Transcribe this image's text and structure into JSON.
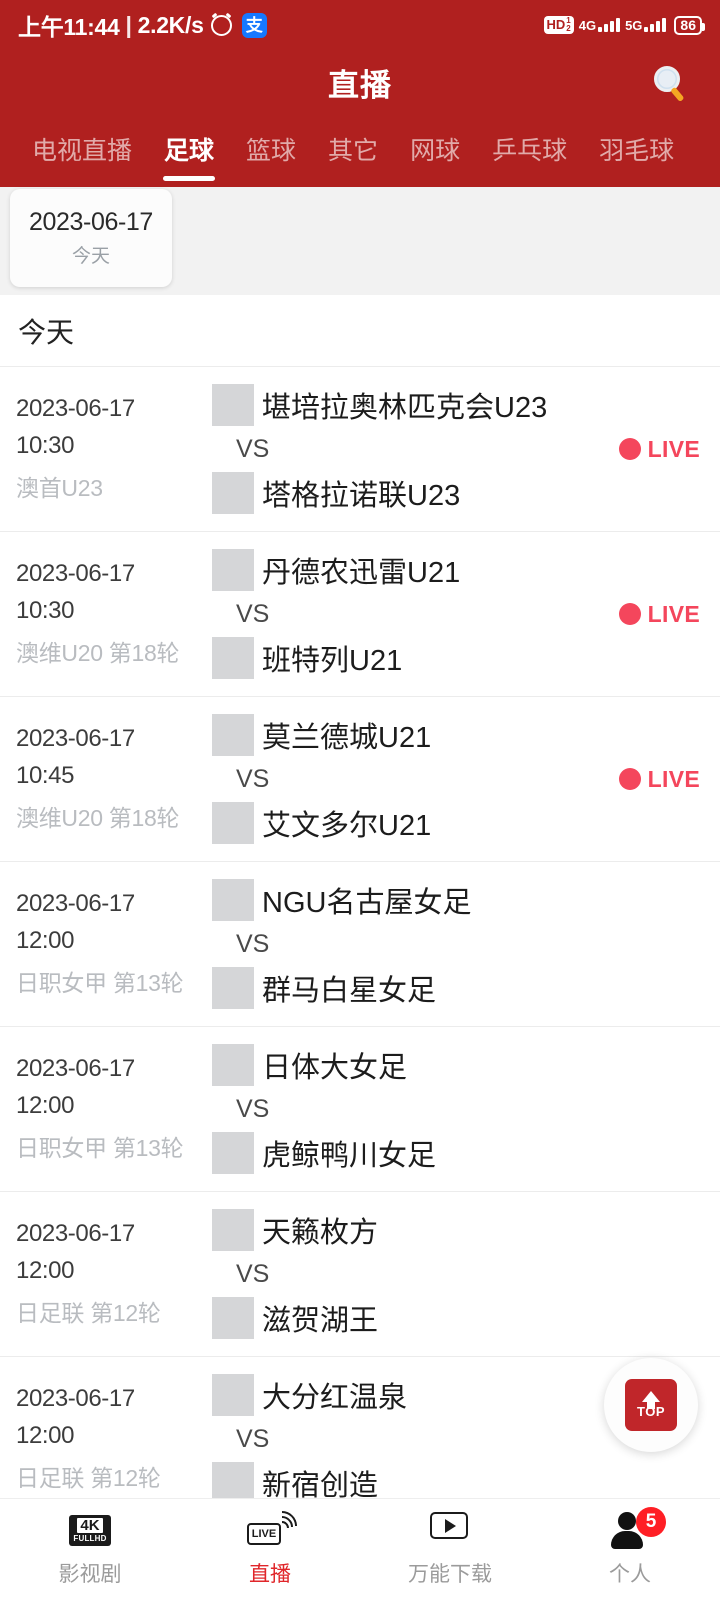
{
  "status_bar": {
    "time": "上午11:44",
    "separator": "|",
    "network_speed": "2.2K/s",
    "alarm_icon": "alarm-clock-icon",
    "alipay_icon": "支",
    "hd_label": "HD",
    "hd_num_top": "1",
    "hd_num_bottom": "2",
    "network_4g": "4G",
    "network_5g": "5G",
    "battery": "86"
  },
  "header": {
    "title": "直播",
    "search_icon": "search-icon"
  },
  "tabs": [
    {
      "label": "电视直播",
      "active": false
    },
    {
      "label": "足球",
      "active": true
    },
    {
      "label": "篮球",
      "active": false
    },
    {
      "label": "其它",
      "active": false
    },
    {
      "label": "网球",
      "active": false
    },
    {
      "label": "乒乓球",
      "active": false
    },
    {
      "label": "羽毛球",
      "active": false
    }
  ],
  "date_chips": [
    {
      "date": "2023-06-17",
      "label": "今天",
      "selected": true
    }
  ],
  "section": {
    "title": "今天"
  },
  "matches": [
    {
      "date": "2023-06-17",
      "time": "10:30",
      "league": "澳首U23",
      "home": "堪培拉奥林匹克会U23",
      "away": "塔格拉诺联U23",
      "vs": "VS",
      "status": "LIVE",
      "live": true
    },
    {
      "date": "2023-06-17",
      "time": "10:30",
      "league": "澳维U20 第18轮",
      "home": "丹德农迅雷U21",
      "away": "班特列U21",
      "vs": "VS",
      "status": "LIVE",
      "live": true
    },
    {
      "date": "2023-06-17",
      "time": "10:45",
      "league": "澳维U20 第18轮",
      "home": "莫兰德城U21",
      "away": "艾文多尔U21",
      "vs": "VS",
      "status": "LIVE",
      "live": true
    },
    {
      "date": "2023-06-17",
      "time": "12:00",
      "league": "日职女甲 第13轮",
      "home": "NGU名古屋女足",
      "away": "群马白星女足",
      "vs": "VS",
      "status": "",
      "live": false
    },
    {
      "date": "2023-06-17",
      "time": "12:00",
      "league": "日职女甲 第13轮",
      "home": "日体大女足",
      "away": "虎鲸鸭川女足",
      "vs": "VS",
      "status": "",
      "live": false
    },
    {
      "date": "2023-06-17",
      "time": "12:00",
      "league": "日足联 第12轮",
      "home": "天籁枚方",
      "away": "滋贺湖王",
      "vs": "VS",
      "status": "",
      "live": false
    },
    {
      "date": "2023-06-17",
      "time": "12:00",
      "league": "日足联 第12轮",
      "home": "大分红温泉",
      "away": "新宿创造",
      "vs": "VS",
      "status": "",
      "live": false
    }
  ],
  "scroll_top_button": {
    "label": "TOP",
    "icon": "arrow-up-icon"
  },
  "bottom_nav": [
    {
      "label": "影视剧",
      "icon": "4k-fullhd-icon",
      "active": false,
      "badge": ""
    },
    {
      "label": "直播",
      "icon": "live-broadcast-icon",
      "active": true,
      "badge": ""
    },
    {
      "label": "万能下载",
      "icon": "video-download-icon",
      "active": false,
      "badge": ""
    },
    {
      "label": "个人",
      "icon": "person-icon",
      "active": false,
      "badge": "5"
    }
  ],
  "colors": {
    "header_red": "#b0201f",
    "accent_red": "#e0262a",
    "live_red": "#f4465c",
    "badge_red": "#ff1f25",
    "muted_gray": "#b9bcc0"
  }
}
